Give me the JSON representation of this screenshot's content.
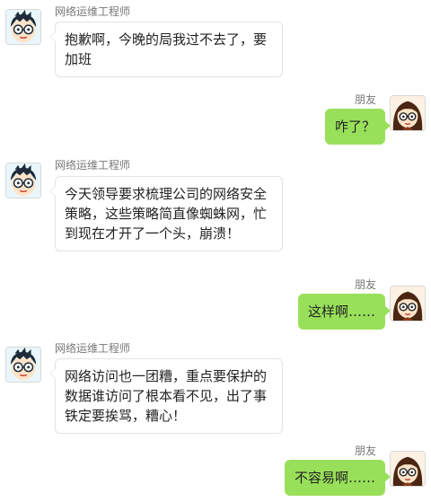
{
  "messages": [
    {
      "sender": "网络运维工程师",
      "side": "left",
      "text": "抱歉啊，今晚的局我过不去了，要加班"
    },
    {
      "sender": "朋友",
      "side": "right",
      "text": "咋了？"
    },
    {
      "sender": "网络运维工程师",
      "side": "left",
      "text": "今天领导要求梳理公司的网络安全策略，这些策略简直像蜘蛛网，忙到现在才开了一个头，崩溃！"
    },
    {
      "sender": "朋友",
      "side": "right",
      "text": "这样啊……"
    },
    {
      "sender": "网络运维工程师",
      "side": "left",
      "text": "网络访问也一团糟，重点要保护的数据谁访问了根本看不见，出了事铁定要挨骂，糟心！"
    },
    {
      "sender": "朋友",
      "side": "right",
      "text": "不容易啊……"
    }
  ],
  "colors": {
    "left_bubble": "#ffffff",
    "right_bubble": "#99e05a",
    "name_text": "#777777"
  },
  "icons": {
    "engineer_avatar": "boy-with-glasses-avatar-icon",
    "friend_avatar": "girl-with-glasses-avatar-icon"
  }
}
